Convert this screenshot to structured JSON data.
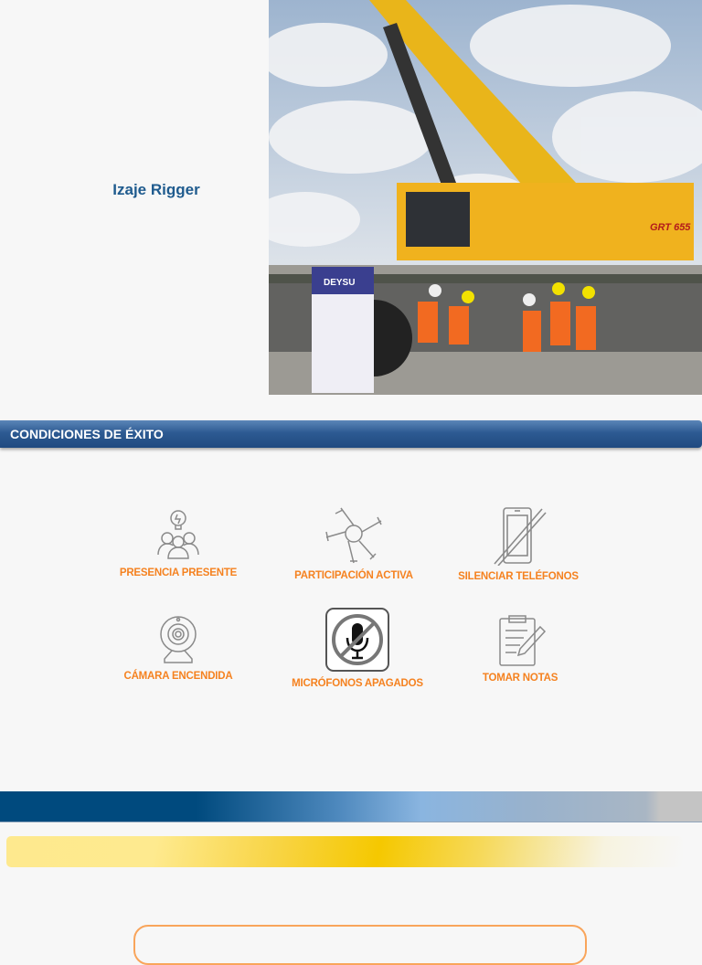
{
  "header": {
    "title": "Izaje Rigger"
  },
  "photo": {
    "banner_text": "DEYSU",
    "crane_model": "GRT 655"
  },
  "section": {
    "title": "CONDICIONES DE ÉXITO"
  },
  "conditions": [
    {
      "label": "PRESENCIA PRESENTE",
      "icon": "people-idea-icon"
    },
    {
      "label": "PARTICIPACIÓN ACTIVA",
      "icon": "joined-hands-icon"
    },
    {
      "label": "SILENCIAR TELÉFONOS",
      "icon": "phone-off-icon"
    },
    {
      "label": "CÁMARA ENCENDIDA",
      "icon": "webcam-icon"
    },
    {
      "label": "MICRÓFONOS APAGADOS",
      "icon": "mic-off-icon"
    },
    {
      "label": "TOMAR NOTAS",
      "icon": "clipboard-notes-icon"
    }
  ],
  "colors": {
    "accent": "#f58220",
    "title_blue": "#1f5b8e",
    "banner": "#2d5a92"
  }
}
